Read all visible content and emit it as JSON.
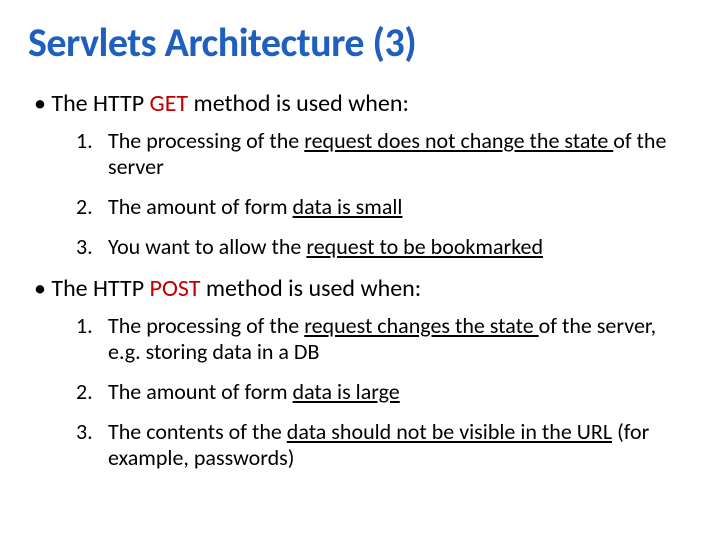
{
  "title": "Servlets Architecture (3)",
  "bullet1": {
    "pre": "• The HTTP ",
    "emph": "GET",
    "post": " method is used when:"
  },
  "list1": {
    "i1": {
      "num": "1.",
      "a": "The processing of the ",
      "u": "request does not change the state ",
      "b": "of the server"
    },
    "i2": {
      "num": "2.",
      "a": "The amount of form ",
      "u": "data is small",
      "b": ""
    },
    "i3": {
      "num": "3.",
      "a": "You want to allow the ",
      "u": "request to be bookmarked",
      "b": ""
    }
  },
  "bullet2": {
    "pre": "• The HTTP ",
    "emph": "POST",
    "post": " method is used when:"
  },
  "list2": {
    "i1": {
      "num": "1.",
      "a": "The processing of the ",
      "u": "request changes the state ",
      "b": "of the server, e.g. storing data in a DB"
    },
    "i2": {
      "num": "2.",
      "a": "The amount of form ",
      "u": "data is large",
      "b": ""
    },
    "i3": {
      "num": "3.",
      "a": "The contents of the ",
      "u": "data should not be visible in the URL",
      "b": " (for example, passwords)"
    }
  }
}
